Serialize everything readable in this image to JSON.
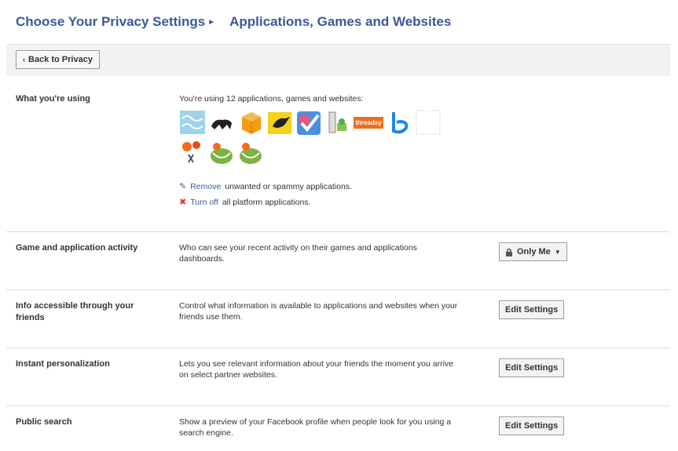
{
  "header": {
    "title": "Choose Your Privacy Settings",
    "subtitle": "Applications, Games and Websites"
  },
  "toolbar": {
    "back_label": "Back to Privacy"
  },
  "using": {
    "label": "What you're using",
    "desc": "You're using 12 applications, games and websites:",
    "app_icons": [
      "cloud-app-icon",
      "anteater-app-icon",
      "box-app-icon",
      "bird-app-icon",
      "checkmark-app-icon",
      "pencil-app-icon",
      "threadsy-app-icon",
      "bing-app-icon",
      "blank-app-icon",
      "flowers-app-icon",
      "frog-app-icon",
      "frog-app-icon"
    ],
    "threadsy_text": "threadsy",
    "remove_link": "Remove",
    "remove_rest": "unwanted or spammy applications.",
    "turnoff_link": "Turn off",
    "turnoff_rest": "all platform applications."
  },
  "rows": [
    {
      "label": "Game and application activity",
      "desc": "Who can see your recent activity on their games and applications dashboards.",
      "control": "Only Me"
    },
    {
      "label": "Info accessible through your friends",
      "desc": "Control what information is available to applications and websites when your friends use them.",
      "control": "Edit Settings"
    },
    {
      "label": "Instant personalization",
      "desc": "Lets you see relevant information about your friends the moment you arrive on select partner websites.",
      "control": "Edit Settings"
    },
    {
      "label": "Public search",
      "desc": "Show a preview of your Facebook profile when people look for you using a search engine.",
      "control": "Edit Settings"
    }
  ]
}
